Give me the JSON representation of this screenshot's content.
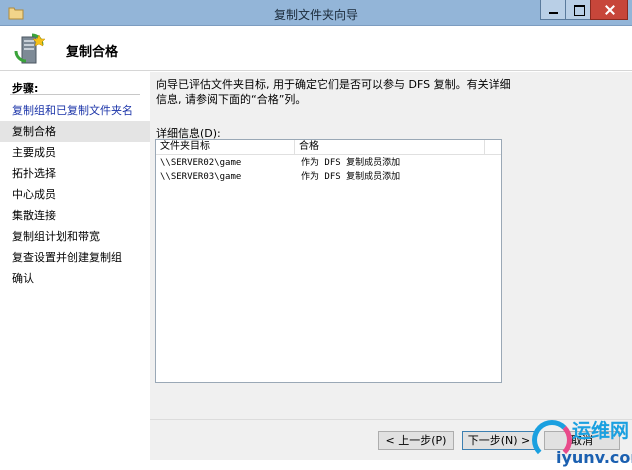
{
  "window": {
    "title": "复制文件夹向导"
  },
  "header": {
    "title": "复制合格"
  },
  "steps": {
    "heading": "步骤:",
    "items": [
      {
        "label": "复制组和已复制文件夹名"
      },
      {
        "label": "复制合格"
      },
      {
        "label": "主要成员"
      },
      {
        "label": "拓扑选择"
      },
      {
        "label": "中心成员"
      },
      {
        "label": "集散连接"
      },
      {
        "label": "复制组计划和带宽"
      },
      {
        "label": "复查设置并创建复制组"
      },
      {
        "label": "确认"
      }
    ]
  },
  "content": {
    "intro": "向导已评估文件夹目标, 用于确定它们是否可以参与 DFS 复制。有关详细信息, 请参阅下面的“合格”列。",
    "detail_label": "详细信息(D):",
    "columns": [
      "文件夹目标",
      "合格"
    ],
    "rows": [
      {
        "target": "\\\\SERVER02\\game",
        "eligibility": "作为 DFS 复制成员添加"
      },
      {
        "target": "\\\\SERVER03\\game",
        "eligibility": "作为 DFS 复制成员添加"
      }
    ]
  },
  "buttons": {
    "prev": "< 上一步(P)",
    "next": "下一步(N) >",
    "cancel": "取消"
  },
  "watermark": {
    "line1": "运维网",
    "line2": "iyunv.com"
  }
}
